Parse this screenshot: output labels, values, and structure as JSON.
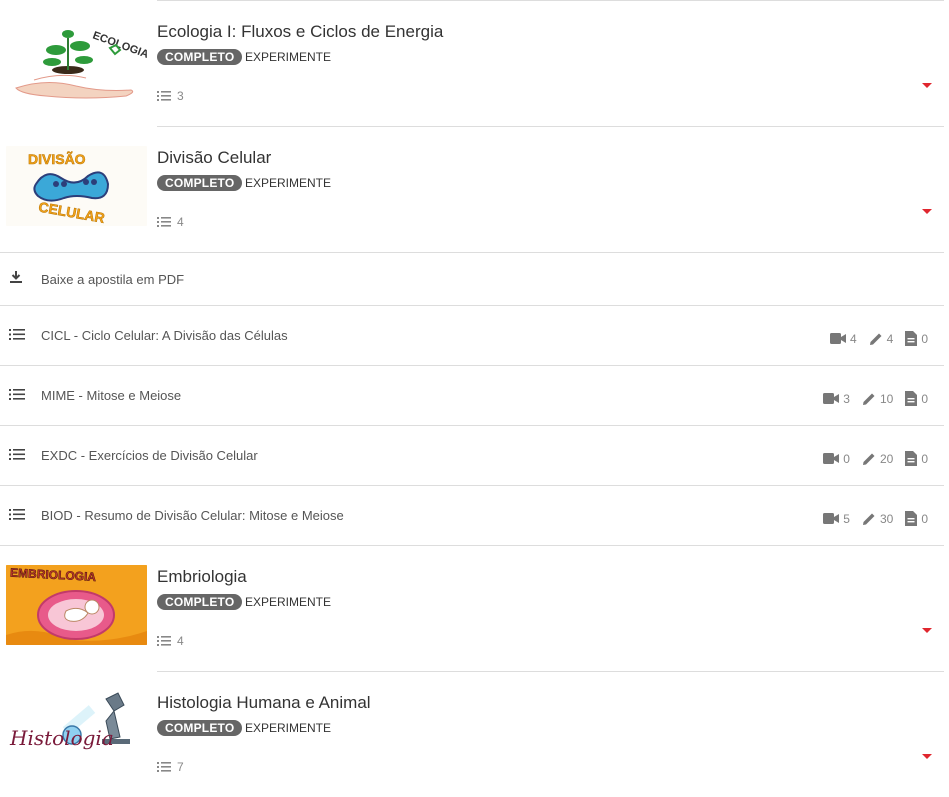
{
  "courses": [
    {
      "title": "Ecologia I: Fluxos e Ciclos de Energia",
      "badge": "COMPLETO",
      "tag": "EXPERIMENTE",
      "count": "3",
      "thumb_text": "ECOLOGIA"
    },
    {
      "title": "Divisão Celular",
      "badge": "COMPLETO",
      "tag": "EXPERIMENTE",
      "count": "4",
      "thumb_text_top": "DIVISÃO",
      "thumb_text_bottom": "CELULAR"
    },
    {
      "title": "Embriologia",
      "badge": "COMPLETO",
      "tag": "EXPERIMENTE",
      "count": "4",
      "thumb_text": "EMBRIOLOGIA"
    },
    {
      "title": "Histologia Humana e Animal",
      "badge": "COMPLETO",
      "tag": "EXPERIMENTE",
      "count": "7",
      "thumb_text": "Histologia"
    }
  ],
  "expanded": {
    "download_label": "Baixe a apostila em PDF",
    "modules": [
      {
        "label": "CICL - Ciclo Celular: A Divisão das Células",
        "videos": "4",
        "exercises": "4",
        "docs": "0"
      },
      {
        "label": "MIME - Mitose e Meiose",
        "videos": "3",
        "exercises": "10",
        "docs": "0"
      },
      {
        "label": "EXDC - Exercícios de Divisão Celular",
        "videos": "0",
        "exercises": "20",
        "docs": "0"
      },
      {
        "label": "BIOD - Resumo de Divisão Celular: Mitose e Meiose",
        "videos": "5",
        "exercises": "30",
        "docs": "0"
      }
    ]
  },
  "colors": {
    "badge_bg": "#666666",
    "caret": "#e0262e",
    "divider": "#dddddd"
  }
}
